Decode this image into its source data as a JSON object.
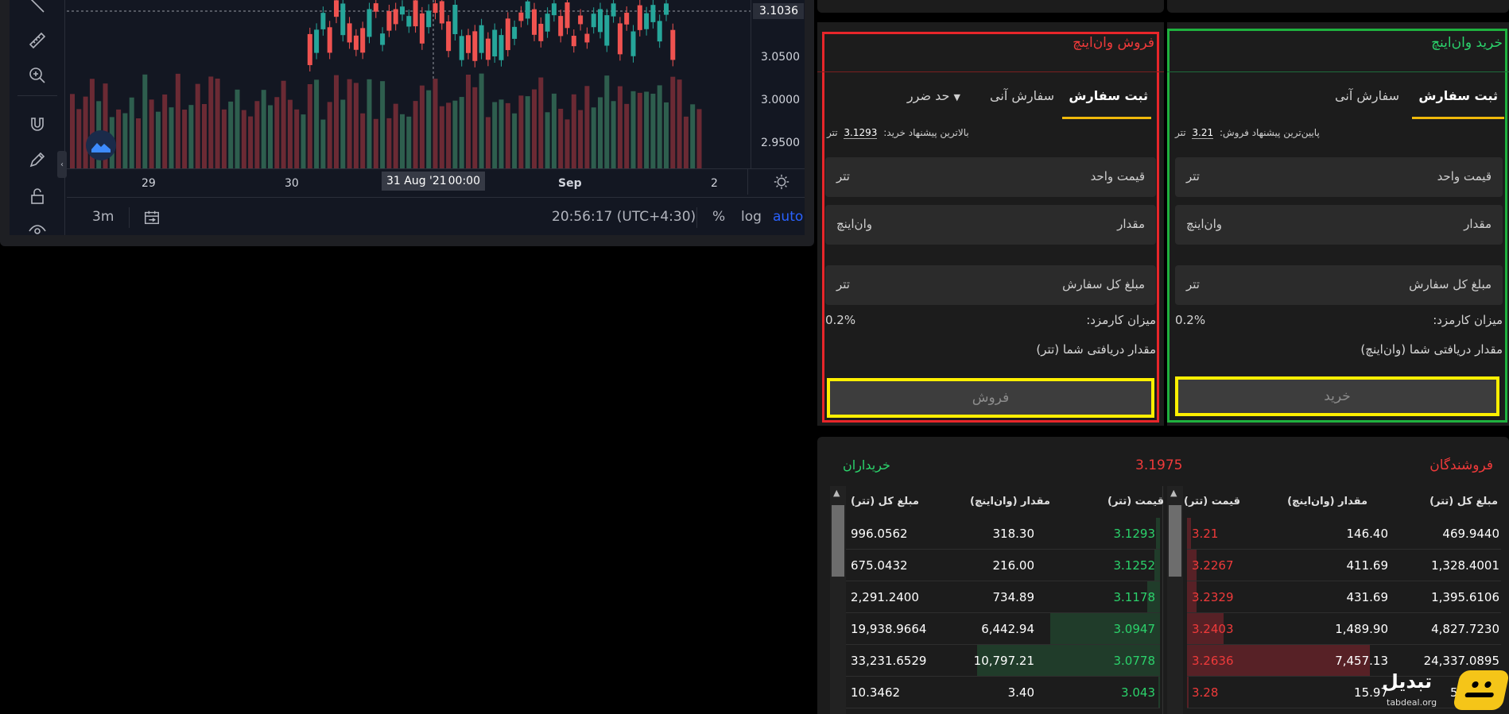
{
  "chart": {
    "price_ticks": [
      "3.0500",
      "3.0000",
      "2.9500"
    ],
    "current_price": "3.1036",
    "time_ticks": [
      "29",
      "30",
      "Sep",
      "2"
    ],
    "crosshair_date": "31 Aug '21",
    "crosshair_time": "00:00",
    "interval": "3m",
    "clock": "20:56:17 (UTC+4:30)",
    "percent_label": "%",
    "log_label": "log",
    "auto_label": "auto",
    "up_color": "#26a69a",
    "down_color": "#ef5350"
  },
  "sell_form": {
    "title": "فروش وان‌اینچ",
    "tabs": [
      "ثبت سفارش",
      "سفارش آنی",
      "حد ضرر"
    ],
    "best_offer_label": "بالاترین پیشنهاد خرید:",
    "best_offer_value": "3.1293",
    "best_offer_unit": "تتر",
    "price_label": "قیمت واحد",
    "price_unit": "تتر",
    "amount_label": "مقدار",
    "amount_unit": "وان‌اینچ",
    "total_label": "مبلغ کل سفارش",
    "total_unit": "تتر",
    "fee_label": "میزان کارمزد:",
    "fee_value": "0.2%",
    "receive_label": "مقدار دریافتی شما (تتر)",
    "submit_label": "فروش",
    "border_color": "#e8262a"
  },
  "buy_form": {
    "title": "خرید وان‌اینچ",
    "tabs": [
      "ثبت سفارش",
      "سفارش آنی"
    ],
    "best_offer_label": "پایین‌ترین پیشنهاد فروش:",
    "best_offer_value": "3.21",
    "best_offer_unit": "تتر",
    "price_label": "قیمت واحد",
    "price_unit": "تتر",
    "amount_label": "مقدار",
    "amount_unit": "وان‌اینچ",
    "total_label": "مبلغ کل سفارش",
    "total_unit": "تتر",
    "fee_label": "میزان کارمزد:",
    "fee_value": "0.2%",
    "receive_label": "مقدار دریافتی شما (وان‌اینچ)",
    "submit_label": "خرید",
    "border_color": "#1fb13f"
  },
  "order_book": {
    "sellers_title": "فروشندگان",
    "buyers_title": "خریداران",
    "last_price": "3.1975",
    "col_price": "قیمت (تتر)",
    "col_amount": "مقدار (وان‌اینچ)",
    "col_total": "مبلغ کل (تتر)",
    "buyers": [
      {
        "price": "3.1293",
        "amount": "318.30",
        "total": "996.0562",
        "depth": 0.02
      },
      {
        "price": "3.1252",
        "amount": "216.00",
        "total": "675.0432",
        "depth": 0.03
      },
      {
        "price": "3.1178",
        "amount": "734.89",
        "total": "2,291.2400",
        "depth": 0.07
      },
      {
        "price": "3.0947",
        "amount": "6,442.94",
        "total": "19,938.9664",
        "depth": 0.6
      },
      {
        "price": "3.0778",
        "amount": "10,797.21",
        "total": "33,231.6529",
        "depth": 1.0
      },
      {
        "price": "3.043",
        "amount": "3.40",
        "total": "10.3462",
        "depth": 0.0
      }
    ],
    "sellers": [
      {
        "price": "3.21",
        "amount": "146.40",
        "total": "469.9440",
        "depth": 0.02
      },
      {
        "price": "3.2267",
        "amount": "411.69",
        "total": "1,328.4001",
        "depth": 0.05
      },
      {
        "price": "3.2329",
        "amount": "431.69",
        "total": "1,395.6106",
        "depth": 0.05
      },
      {
        "price": "3.2403",
        "amount": "1,489.90",
        "total": "4,827.7230",
        "depth": 0.2
      },
      {
        "price": "3.2636",
        "amount": "7,457.13",
        "total": "24,337.0895",
        "depth": 1.0
      },
      {
        "price": "3.28",
        "amount": "15.97",
        "total": "52.3816",
        "depth": 0.01
      }
    ]
  },
  "watermark": {
    "brand": "تبدیل",
    "domain": "tabdeal.org"
  }
}
